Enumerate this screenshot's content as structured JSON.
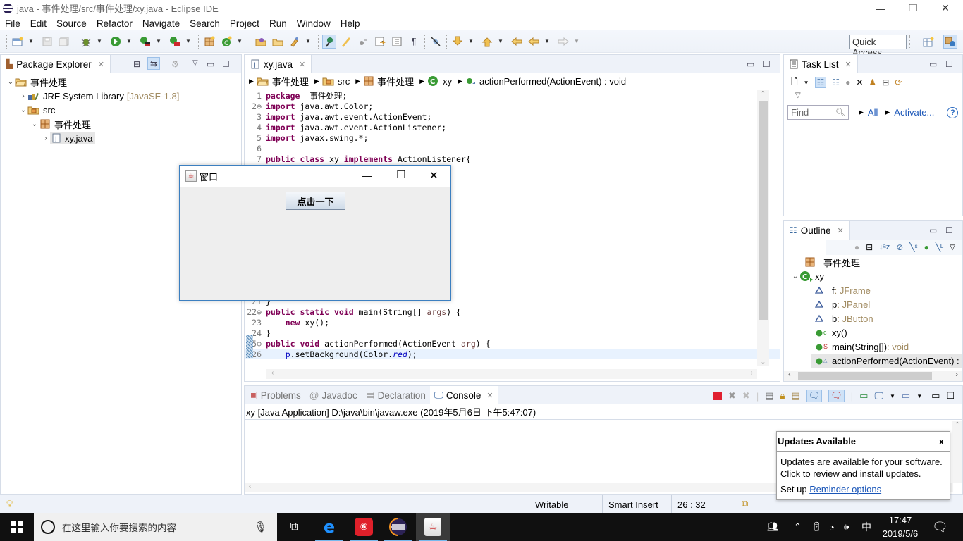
{
  "window": {
    "title": "java - 事件处理/src/事件处理/xy.java - Eclipse IDE",
    "controls": {
      "minimize": "—",
      "restore": "❐",
      "close": "✕"
    }
  },
  "menu": [
    "File",
    "Edit",
    "Source",
    "Refactor",
    "Navigate",
    "Search",
    "Project",
    "Run",
    "Window",
    "Help"
  ],
  "toolbar": {
    "quick_access": "Quick Access",
    "icons": [
      "new-wizard-icon",
      "save-icon",
      "save-all-icon",
      "debug-icon",
      "run-icon",
      "coverage-icon",
      "external-tools-icon",
      "new-package-icon",
      "new-class-icon",
      "open-type-icon",
      "open-task-icon",
      "search-icon",
      "toggle-mark-occurrences-icon",
      "toggle-highlight-icon",
      "toggle-word-wrap-icon",
      "toggle-block-selection-icon",
      "show-whitespace-icon",
      "skip-breakpoints-icon",
      "next-annotation-icon",
      "previous-annotation-icon",
      "last-edit-location-icon",
      "back-icon",
      "forward-icon"
    ]
  },
  "package_explorer": {
    "tab_label": "Package Explorer",
    "tree": [
      {
        "label": "事件处理",
        "icon": "project-icon",
        "expanded": true,
        "level": 0
      },
      {
        "label": "JRE System Library",
        "suffix": "[JavaSE-1.8]",
        "icon": "library-icon",
        "expanded": false,
        "level": 1
      },
      {
        "label": "src",
        "icon": "source-folder-icon",
        "expanded": true,
        "level": 1
      },
      {
        "label": "事件处理",
        "icon": "package-icon",
        "expanded": true,
        "level": 2
      },
      {
        "label": "xy.java",
        "icon": "java-file-icon",
        "expanded": false,
        "level": 3,
        "selected": true
      }
    ]
  },
  "editor": {
    "tab_label": "xy.java",
    "breadcrumb": [
      "事件处理",
      "src",
      "事件处理",
      "xy",
      "actionPerformed(ActionEvent) : void"
    ],
    "lines_top": [
      {
        "n": "1",
        "code": [
          [
            "kw",
            "package"
          ],
          [
            "",
            "  事件处理;"
          ]
        ]
      },
      {
        "n": "2⊖",
        "code": [
          [
            "kw",
            "import"
          ],
          [
            "",
            " java.awt.Color;"
          ]
        ]
      },
      {
        "n": "3",
        "code": [
          [
            "kw",
            "import"
          ],
          [
            "",
            " java.awt.event.ActionEvent;"
          ]
        ]
      },
      {
        "n": "4",
        "code": [
          [
            "kw",
            "import"
          ],
          [
            "",
            " java.awt.event.ActionListener;"
          ]
        ]
      },
      {
        "n": "5",
        "code": [
          [
            "kw",
            "import"
          ],
          [
            "",
            " javax.swing.*;"
          ]
        ]
      },
      {
        "n": "6",
        "code": []
      },
      {
        "n": "7",
        "code": [
          [
            "kw",
            "public class"
          ],
          [
            "",
            " xy "
          ],
          [
            "kw",
            "implements"
          ],
          [
            "",
            " ActionListener{"
          ]
        ]
      }
    ],
    "lines_bottom": [
      {
        "n": "21",
        "code": [
          [
            "",
            "}"
          ]
        ]
      },
      {
        "n": "22⊖",
        "code": [
          [
            "kw",
            "public static void"
          ],
          [
            "",
            " main(String[] "
          ],
          [
            "prm",
            "args"
          ],
          [
            "",
            ") {"
          ]
        ]
      },
      {
        "n": "23",
        "code": [
          [
            "",
            "    "
          ],
          [
            "kw",
            "new"
          ],
          [
            "",
            " xy();"
          ]
        ]
      },
      {
        "n": "24",
        "code": [
          [
            "",
            "}"
          ]
        ]
      },
      {
        "n": "25⊖",
        "code": [
          [
            "kw",
            "public void"
          ],
          [
            "",
            " actionPerformed(ActionEvent "
          ],
          [
            "prm",
            "arg"
          ],
          [
            "",
            ") {"
          ]
        ]
      },
      {
        "n": "26",
        "code": [
          [
            "",
            "    "
          ],
          [
            "fld",
            "p"
          ],
          [
            "",
            ".setBackground(Color."
          ],
          [
            "it",
            "red"
          ],
          [
            "",
            ");"
          ]
        ],
        "current": true
      }
    ]
  },
  "swing_window": {
    "title": "窗口",
    "button_label": "点击一下",
    "controls": {
      "minimize": "—",
      "maximize": "☐",
      "close": "✕"
    }
  },
  "task_list": {
    "tab_label": "Task List",
    "find_placeholder": "Find",
    "links": [
      "All",
      "Activate..."
    ],
    "help": "?"
  },
  "outline": {
    "tab_label": "Outline",
    "items": [
      {
        "label": "事件处理",
        "icon": "package-icon",
        "level": 0
      },
      {
        "label": "xy",
        "icon": "class-icon",
        "level": 0,
        "expanded": true
      },
      {
        "label": "f",
        "type": " : JFrame",
        "icon": "field-icon",
        "level": 1
      },
      {
        "label": "p",
        "type": " : JPanel",
        "icon": "field-icon",
        "level": 1
      },
      {
        "label": "b",
        "type": " : JButton",
        "icon": "field-icon",
        "level": 1
      },
      {
        "label": "xy()",
        "type": "",
        "icon": "constructor-icon",
        "badge": "c",
        "level": 1
      },
      {
        "label": "main(String[])",
        "type": " : void",
        "icon": "static-method-icon",
        "badge": "S",
        "level": 1
      },
      {
        "label": "actionPerformed(ActionEvent) :",
        "type": "",
        "icon": "method-icon",
        "badge": "",
        "level": 1,
        "selected": true
      }
    ]
  },
  "bottom_panel": {
    "tabs": [
      "Problems",
      "Javadoc",
      "Declaration",
      "Console"
    ],
    "active_tab": "Console",
    "console_header": "xy [Java Application] D:\\java\\bin\\javaw.exe (2019年5月6日 下午5:47:07)"
  },
  "status_bar": {
    "writable": "Writable",
    "insert_mode": "Smart Insert",
    "position": "26 : 32"
  },
  "notification": {
    "title": "Updates Available",
    "close": "x",
    "line1": "Updates are available for your software.",
    "line2": "Click to review and install updates.",
    "setup_prefix": "Set up ",
    "setup_link": "Reminder options"
  },
  "taskbar": {
    "search_placeholder": "在这里输入你要搜索的内容",
    "time": "17:47",
    "date": "2019/5/6",
    "ime": "中"
  },
  "colors": {
    "keyword": "#7f0055",
    "accent": "#3c7fc0",
    "link": "#1a56b8"
  }
}
